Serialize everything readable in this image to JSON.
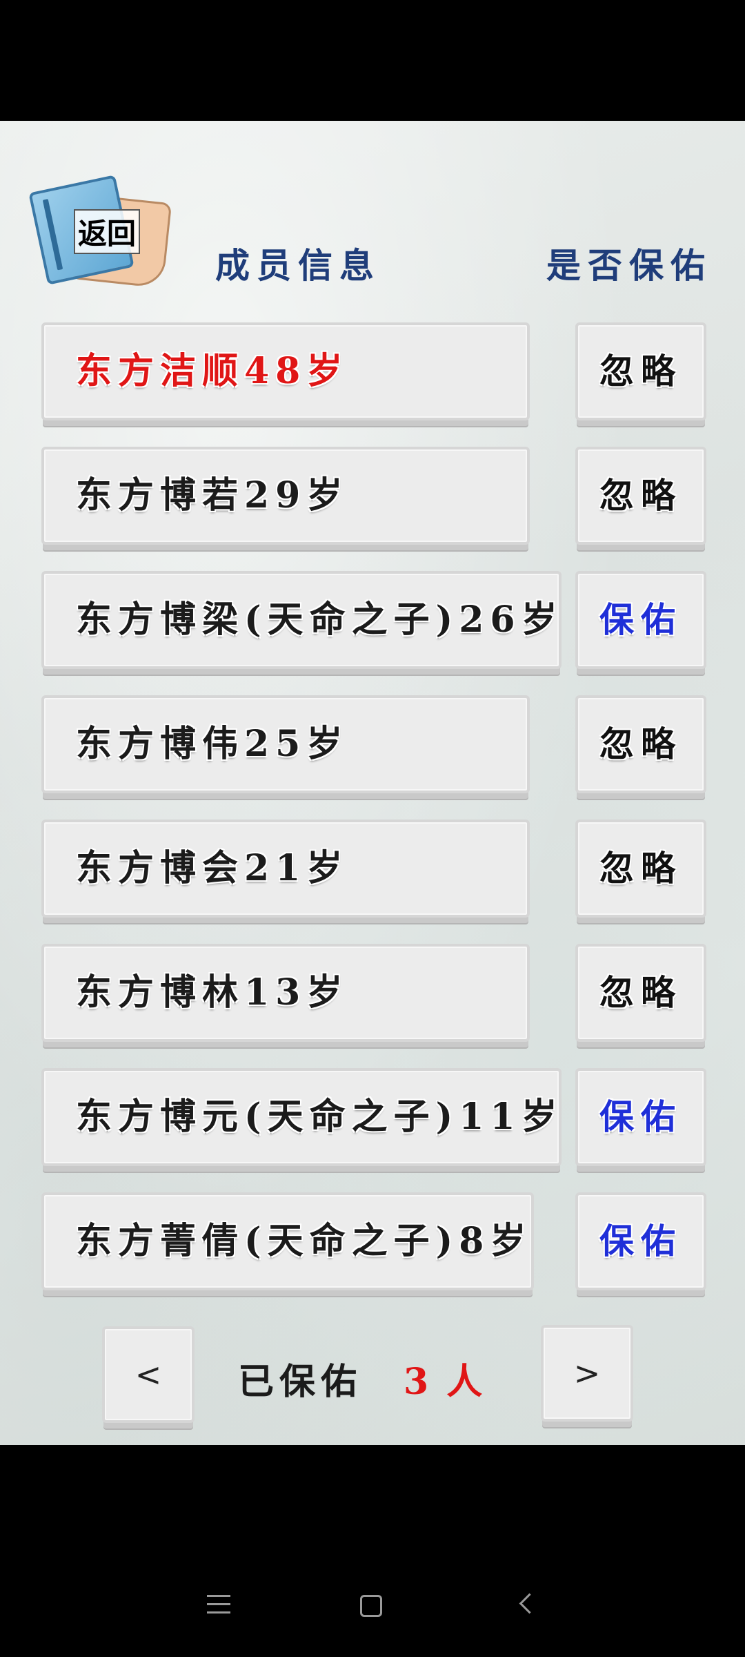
{
  "header": {
    "back_label": "返回",
    "members_title": "成员信息",
    "bless_title": "是否保佑"
  },
  "members": [
    {
      "name": "东方洁顺48岁",
      "action": "忽略",
      "highlighted": true
    },
    {
      "name": "东方博若29岁",
      "action": "忽略"
    },
    {
      "name": "东方博梁(天命之子)26岁",
      "action": "保佑"
    },
    {
      "name": "东方博伟25岁",
      "action": "忽略"
    },
    {
      "name": "东方博会21岁",
      "action": "忽略"
    },
    {
      "name": "东方博林13岁",
      "action": "忽略"
    },
    {
      "name": "东方博元(天命之子)11岁",
      "action": "保佑"
    },
    {
      "name": "东方菁倩(天命之子)8岁",
      "action": "保佑"
    }
  ],
  "footer": {
    "prev_label": "<",
    "next_label": ">",
    "blessed_label": "已保佑",
    "blessed_count": "3",
    "blessed_unit": "人"
  },
  "colors": {
    "highlight_name": "#e01616",
    "bless_action": "#1f2fd8",
    "header_text": "#1f3d7a"
  },
  "system_nav": {
    "menu_icon": "menu-icon",
    "home_icon": "home-icon",
    "back_icon": "back-arrow-icon"
  }
}
